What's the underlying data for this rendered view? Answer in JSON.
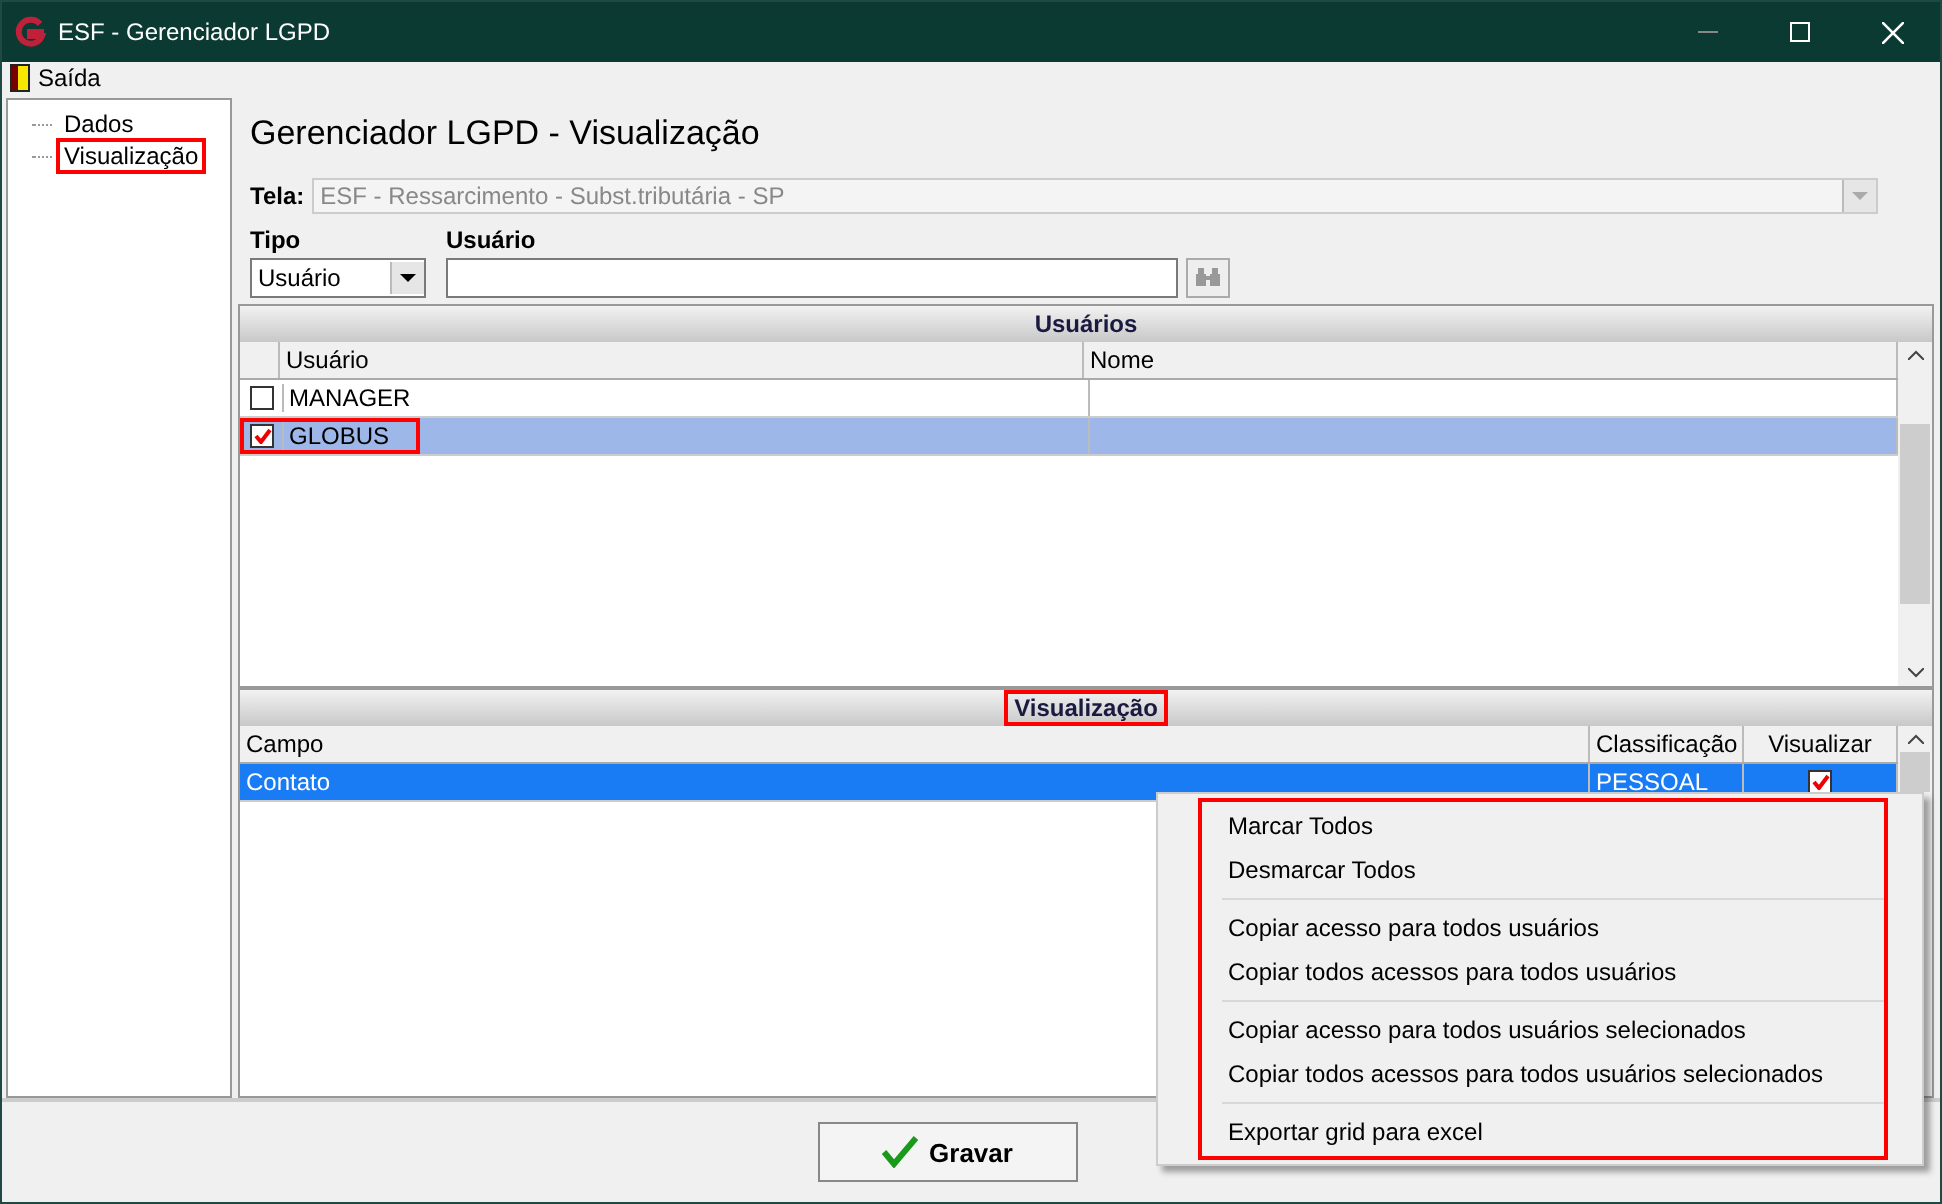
{
  "window": {
    "title": "ESF - Gerenciador LGPD"
  },
  "menu_bar": [
    {
      "label": "Saída"
    }
  ],
  "sidebar": {
    "items": [
      {
        "label": "Dados",
        "highlighted": false
      },
      {
        "label": "Visualização",
        "highlighted": true
      }
    ]
  },
  "page_title": "Gerenciador LGPD - Visualização",
  "tela": {
    "label": "Tela:",
    "value": "ESF - Ressarcimento - Subst.tributária - SP",
    "disabled": true
  },
  "tipo": {
    "label": "Tipo",
    "value": "Usuário"
  },
  "usuario": {
    "label": "Usuário"
  },
  "users_grid": {
    "title": "Usuários",
    "title_highlighted": false,
    "columns": [
      "Usuário",
      "Nome"
    ],
    "rows": [
      {
        "usuario": "MANAGER",
        "checked": false,
        "selected": false,
        "highlighted": false
      },
      {
        "usuario": "GLOBUS",
        "checked": true,
        "selected": true,
        "highlighted": true
      }
    ]
  },
  "fields_grid": {
    "title": "Visualização",
    "title_highlighted": true,
    "columns": [
      "Campo",
      "Classificação",
      "Visualizar"
    ],
    "rows": [
      {
        "campo": "Contato",
        "classificacao": "PESSOAL",
        "visualizar": true,
        "selected": true
      }
    ]
  },
  "context_menu": {
    "highlighted": true,
    "groups": [
      [
        "Marcar Todos",
        "Desmarcar Todos"
      ],
      [
        "Copiar acesso para todos usuários",
        "Copiar todos acessos para todos usuários"
      ],
      [
        "Copiar acesso para todos usuários selecionados",
        "Copiar todos acessos para todos usuários selecionados"
      ],
      [
        "Exportar grid para excel"
      ]
    ]
  },
  "save_button": {
    "label": "Gravar"
  }
}
